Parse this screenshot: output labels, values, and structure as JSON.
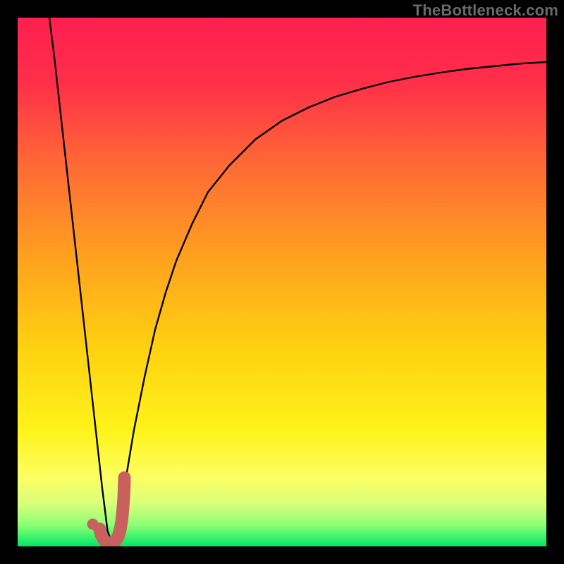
{
  "watermark": "TheBottleneck.com",
  "colors": {
    "frame": "#000000",
    "gradient_stops": [
      {
        "offset": 0.0,
        "color": "#ff1f4f"
      },
      {
        "offset": 0.12,
        "color": "#ff2e49"
      },
      {
        "offset": 0.28,
        "color": "#ff6a35"
      },
      {
        "offset": 0.45,
        "color": "#ffa01f"
      },
      {
        "offset": 0.62,
        "color": "#ffd011"
      },
      {
        "offset": 0.78,
        "color": "#fff31a"
      },
      {
        "offset": 0.87,
        "color": "#fcff62"
      },
      {
        "offset": 0.92,
        "color": "#d8ff7a"
      },
      {
        "offset": 0.96,
        "color": "#8cff74"
      },
      {
        "offset": 1.0,
        "color": "#00e765"
      }
    ],
    "curve": "#000000",
    "marker": "#c9605e"
  },
  "chart_data": {
    "type": "line",
    "title": "",
    "xlabel": "",
    "ylabel": "",
    "xlim": [
      0,
      100
    ],
    "ylim": [
      0,
      100
    ],
    "series": [
      {
        "name": "bottleneck-curve",
        "x": [
          6,
          7,
          8,
          9,
          10,
          11,
          12,
          13,
          14,
          15,
          16,
          17,
          18,
          19,
          20,
          22,
          24,
          26,
          28,
          30,
          33,
          36,
          40,
          45,
          50,
          55,
          60,
          65,
          70,
          75,
          80,
          85,
          90,
          95,
          100
        ],
        "y": [
          100,
          92,
          83,
          74,
          65,
          56,
          47,
          38,
          29,
          20,
          11,
          3,
          0,
          3,
          10,
          22,
          32,
          41,
          48,
          54,
          61,
          67,
          72,
          77,
          80.5,
          83,
          85,
          86.5,
          87.8,
          88.8,
          89.6,
          90.3,
          90.8,
          91.3,
          91.6
        ]
      }
    ],
    "marker_curve": {
      "name": "j-marker",
      "x": [
        15.5,
        15.8,
        16.2,
        16.8,
        17.6,
        18.4,
        19.0,
        19.4,
        19.7,
        19.9,
        20.05,
        20.15,
        20.2
      ],
      "y": [
        3.3,
        2.2,
        1.4,
        0.8,
        0.6,
        0.9,
        1.8,
        3.2,
        5.0,
        7.0,
        9.0,
        11.0,
        13.0
      ]
    },
    "marker_point": {
      "x": 14.2,
      "y": 4.2
    }
  }
}
